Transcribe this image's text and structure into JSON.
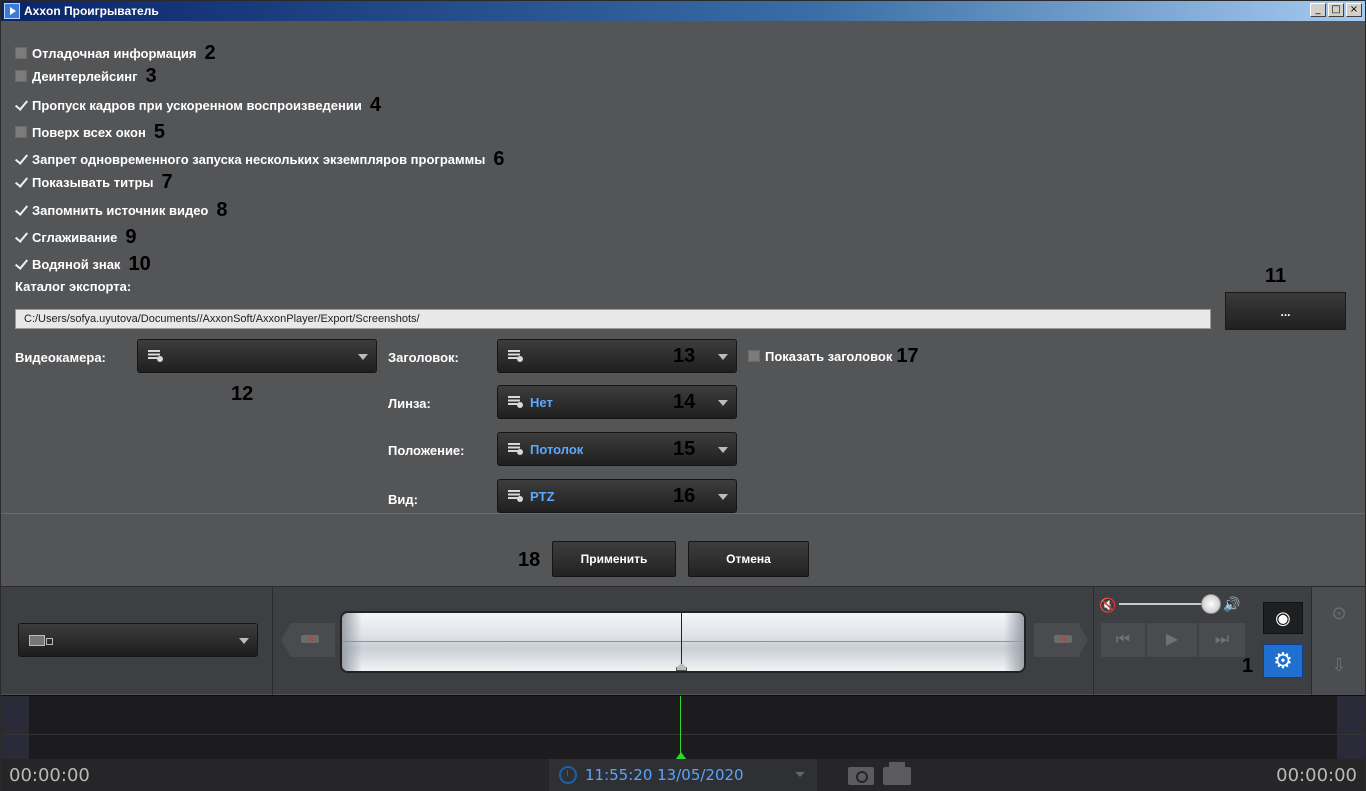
{
  "window": {
    "title": "Axxon Проигрыватель",
    "buttons": [
      "_",
      "□",
      "×"
    ]
  },
  "settings": {
    "checkboxes": [
      {
        "label": "Отладочная информация",
        "checked": false,
        "num": "2"
      },
      {
        "label": "Деинтерлейсинг",
        "checked": false,
        "num": "3"
      },
      {
        "label": "Пропуск кадров при ускоренном воспроизведении",
        "checked": true,
        "num": "4"
      },
      {
        "label": "Поверх всех окон",
        "checked": false,
        "num": "5"
      },
      {
        "label": "Запрет одновременного запуска нескольких экземпляров программы",
        "checked": true,
        "num": "6"
      },
      {
        "label": "Показывать титры",
        "checked": true,
        "num": "7"
      },
      {
        "label": "Запомнить источник видео",
        "checked": true,
        "num": "8"
      },
      {
        "label": "Сглаживание",
        "checked": true,
        "num": "9"
      },
      {
        "label": "Водяной знак",
        "checked": true,
        "num": "10"
      }
    ],
    "export_label": "Каталог экспорта:",
    "export_path": "C:/Users/sofya.uyutova/Documents//AxxonSoft/AxxonPlayer/Export/Screenshots/",
    "browse_label": "...",
    "browse_num": "11",
    "camera_label": "Видеокамера:",
    "camera_value": "",
    "camera_num": "12",
    "header_label": "Заголовок:",
    "header_value": "",
    "header_num": "13",
    "show_header_label": "Показать заголовок",
    "show_header_checked": false,
    "show_header_num": "17",
    "lens_label": "Линза:",
    "lens_value": "Нет",
    "lens_num": "14",
    "position_label": "Положение:",
    "position_value": "Потолок",
    "position_num": "15",
    "view_label": "Вид:",
    "view_value": "PTZ",
    "view_num": "16",
    "apply_num": "18",
    "apply_label": "Применить",
    "cancel_label": "Отмена"
  },
  "player": {
    "settings_num": "1",
    "time_start": "00:00:00",
    "time_end": "00:00:00",
    "datetime": "11:55:20 13/05/2020",
    "accent": "#1f6fd1",
    "marker_color": "#2fd62f"
  }
}
